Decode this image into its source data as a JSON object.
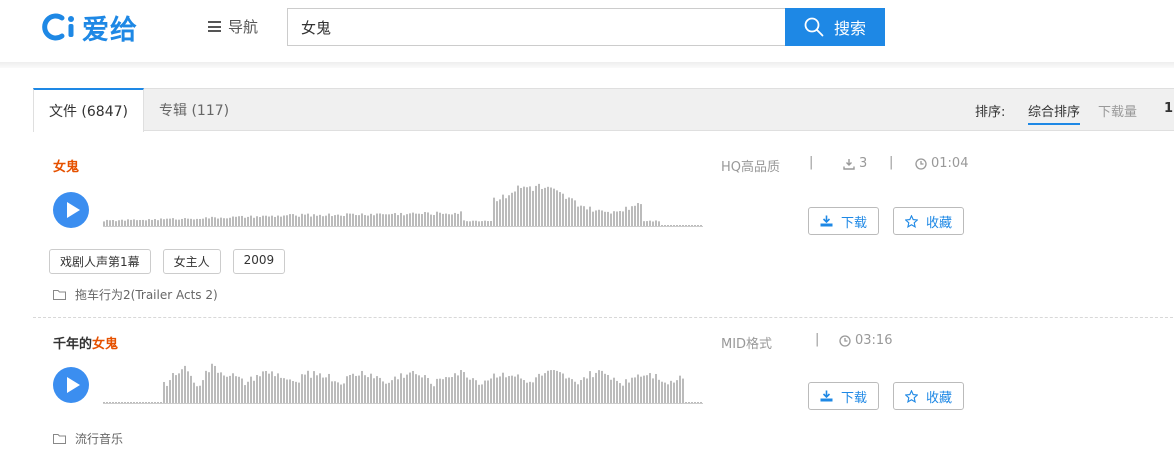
{
  "header": {
    "logo_text": "爱给",
    "nav_label": "导航",
    "search_value": "女鬼",
    "search_button": "搜索",
    "accent_color": "#1e88e5"
  },
  "tabs": [
    {
      "label": "文件 (6847)",
      "active": true
    },
    {
      "label": "专辑 (117)",
      "active": false
    }
  ],
  "sort": {
    "label": "排序:",
    "options": [
      "综合排序",
      "下载量"
    ],
    "selected": "综合排序",
    "page": "1"
  },
  "results": [
    {
      "title_pre": "",
      "title_hl": "女鬼",
      "format": "HQ高品质",
      "downloads": "3",
      "duration": "01:04",
      "tags": [
        "戏剧人声第1幕",
        "女主人",
        "2009"
      ],
      "album": "拖车行为2(Trailer Acts 2)",
      "download_label": "下载",
      "favorite_label": "收藏",
      "icons": [
        "play-icon",
        "download-count-icon",
        "clock-icon",
        "folder-icon",
        "download-icon",
        "star-icon"
      ]
    },
    {
      "title_pre": "千年的",
      "title_hl": "女鬼",
      "format": "MID格式",
      "duration": "03:16",
      "tags": [],
      "album": "流行音乐",
      "download_label": "下载",
      "favorite_label": "收藏",
      "icons": [
        "play-icon",
        "clock-icon",
        "folder-icon",
        "download-icon",
        "star-icon"
      ]
    }
  ]
}
